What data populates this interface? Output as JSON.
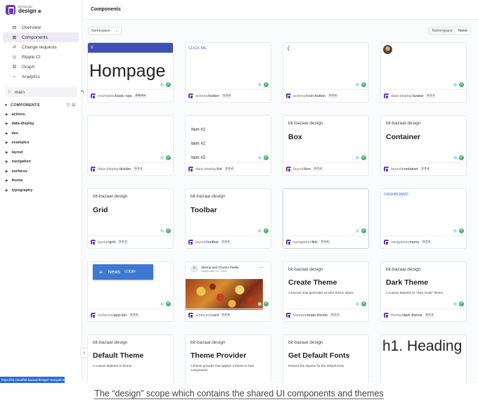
{
  "brand": {
    "org": "bit-bazaar",
    "scope": "design"
  },
  "nav": [
    {
      "icon": "▤",
      "label": "Overview"
    },
    {
      "icon": "▦",
      "label": "Components",
      "active": true
    },
    {
      "icon": "⇄",
      "label": "Change requests"
    },
    {
      "icon": "◎",
      "label": "Ripple CI"
    },
    {
      "icon": "⌘",
      "label": "Graph"
    },
    {
      "icon": "⌁",
      "label": "Analytics"
    }
  ],
  "branch": {
    "label": "main"
  },
  "tree": {
    "header": "COMPONENTS",
    "items": [
      "actions",
      "data-display",
      "dev",
      "examples",
      "layout",
      "navigation",
      "surfaces",
      "theme",
      "typography"
    ]
  },
  "topbar": {
    "title": "Components"
  },
  "filters": {
    "namespace_select": "Namespace",
    "toggle_label": "Namespace",
    "toggle_value": "None"
  },
  "cards": [
    {
      "ns": "examples/",
      "name": "basic-spa",
      "ver": "0f6e6e",
      "preview": {
        "bar": "≡",
        "big": "Hompage"
      }
    },
    {
      "ns": "actions/",
      "name": "button",
      "ver": "0.0.6",
      "preview": {
        "click": "CLICK ME"
      }
    },
    {
      "ns": "actions/",
      "name": "icon-button",
      "ver": "0.0.6",
      "preview": {
        "moon": "☾"
      }
    },
    {
      "ns": "data-display/",
      "name": "avatar",
      "ver": "0.0.4"
    },
    {
      "ns": "data-display/",
      "name": "divider",
      "ver": "0.0.4"
    },
    {
      "ns": "data-display/",
      "name": "list",
      "ver": "0.0.4",
      "preview": {
        "items": [
          "Item #1",
          "Item #2",
          "Item #3"
        ]
      }
    },
    {
      "ns": "layout/",
      "name": "box",
      "ver": "0.0.4",
      "preview": {
        "scope": "bit-bazaar.design",
        "title": "Box"
      }
    },
    {
      "ns": "layout/",
      "name": "container",
      "ver": "0.0.4",
      "preview": {
        "scope": "bit-bazaar.design",
        "title": "Container"
      }
    },
    {
      "ns": "layout/",
      "name": "grid",
      "ver": "0.0.3",
      "preview": {
        "scope": "bit-bazaar.design",
        "title": "Grid"
      }
    },
    {
      "ns": "layout/",
      "name": "toolbar",
      "ver": "0.0.4",
      "preview": {
        "scope": "bit-bazaar.design",
        "title": "Toolbar"
      }
    },
    {
      "ns": "navigation/",
      "name": "link",
      "ver": "0.0.6"
    },
    {
      "ns": "navigation/",
      "name": "menu",
      "ver": "0.0.6",
      "preview": {
        "dash": "DASHBOARD"
      }
    },
    {
      "ns": "surfaces/",
      "name": "app-bar",
      "ver": "0.0.6",
      "preview": {
        "title": "News",
        "login": "LOGIN"
      }
    },
    {
      "ns": "surfaces/",
      "name": "card",
      "ver": "0.0.6",
      "preview": {
        "author": "Shrimp and Chorizo Paella",
        "date": "September 14, 2016",
        "avatar": "R"
      }
    },
    {
      "ns": "theme/",
      "name": "create-theme",
      "ver": "0.0.4",
      "preview": {
        "scope": "bit-bazaar.design",
        "title": "Create Theme",
        "desc": "A function that generates an MUI theme object."
      }
    },
    {
      "ns": "theme/",
      "name": "dark-theme",
      "ver": "0.0.4",
      "preview": {
        "scope": "bit-bazaar.design",
        "title": "Dark Theme",
        "desc": "A custom Material UI \"dark mode\" theme."
      }
    },
    {
      "preview": {
        "scope": "bit-bazaar.design",
        "title": "Default Theme",
        "desc": "A custom Material UI theme."
      }
    },
    {
      "preview": {
        "scope": "bit-bazaar.design",
        "title": "Theme Provider",
        "desc": "A theme provider that applies a theme to MUI components"
      }
    },
    {
      "preview": {
        "scope": "bit-bazaar.design",
        "title": "Get Default Fonts",
        "desc": "Returns the imports for the default fonts."
      }
    },
    {
      "preview": {
        "heading": "h1. Heading"
      }
    }
  ],
  "status_url": "https://bit.cloud/bit-bazaar/design/~navigation/link",
  "caption": "The “design” scope which contains the shared UI components and themes",
  "colors": {
    "brand": "#6c3ab0",
    "appbar": "#3f51b5",
    "status_ok": "#4fb46e"
  }
}
